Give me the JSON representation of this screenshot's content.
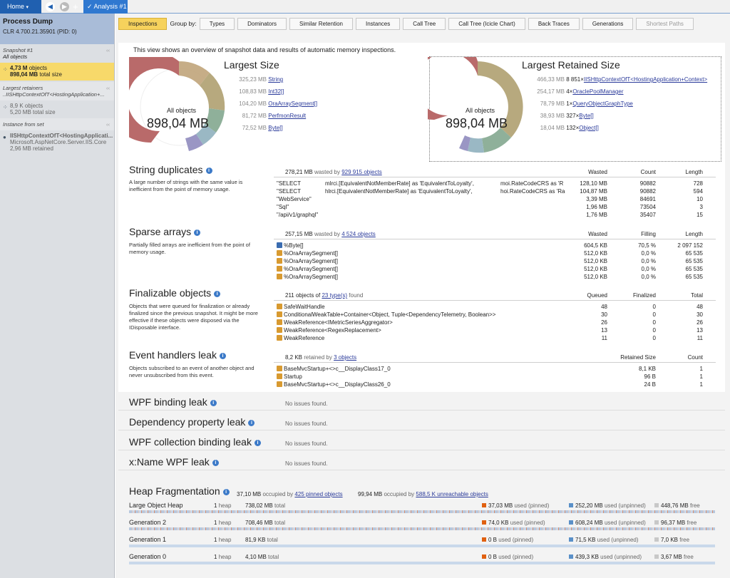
{
  "topbar": {
    "home": "Home",
    "analysis_tab": "Analysis #1",
    "plus": "+"
  },
  "sidebar": {
    "title": "Process Dump",
    "clr": "CLR 4.700.21.35901 (PID: 0)",
    "snapshot_label": "Snapshot #1",
    "snapshot_sub": "All objects",
    "sel_objects": "4,73 M",
    "sel_objects_lbl": "objects",
    "sel_size": "898,04 MB",
    "sel_size_lbl": "total size",
    "retainers_label": "Largest retainers",
    "retainers_sub": "..IISHttpContextOfT<HostingApplication+...",
    "ret_objects": "8,9 K",
    "ret_objects_lbl": "objects",
    "ret_size": "5,20 MB",
    "ret_size_lbl": "total size",
    "instance_label": "Instance from set",
    "inst_name": "IISHttpContextOfT<HostingApplicati...",
    "inst_ns": "Microsoft.AspNetCore.Server.IIS.Core",
    "inst_ret": "2,96 MB retained",
    "collapse": "‹‹"
  },
  "tabs": {
    "inspections": "Inspections",
    "group_by": "Group by:",
    "types": "Types",
    "dominators": "Dominators",
    "similar": "Similar Retention",
    "instances": "Instances",
    "calltree": "Call Tree",
    "icicle": "Call Tree (Icicle Chart)",
    "backtraces": "Back Traces",
    "generations": "Generations",
    "shortest": "Shortest Paths"
  },
  "overview": {
    "text": "This view shows an overview of snapshot data and results of automatic memory inspections.",
    "largest_size": "Largest Size",
    "largest_retained": "Largest Retained Size",
    "all_objects": "All objects",
    "total": "898,04 MB",
    "ls_items": [
      {
        "v": "325,23 MB",
        "n": "String",
        "p": ""
      },
      {
        "v": "108,83 MB",
        "n": "Int32[]",
        "p": ""
      },
      {
        "v": "104,20 MB",
        "n": "OraArraySegment[]",
        "p": ""
      },
      {
        "v": "81,72 MB",
        "n": "PerfmonResult",
        "p": ""
      },
      {
        "v": "72,52 MB",
        "n": "Byte[]",
        "p": ""
      }
    ],
    "lr_items": [
      {
        "v": "466,33 MB",
        "p": "8 851×",
        "n": "IISHttpContextOfT<HostingApplication+Context>"
      },
      {
        "v": "254,17 MB",
        "p": "4×",
        "n": "OraclePoolManager"
      },
      {
        "v": "78,79 MB",
        "p": "1×",
        "n": "QueryObjectGraphType"
      },
      {
        "v": "38,93 MB",
        "p": "327×",
        "n": "Byte[]"
      },
      {
        "v": "18,04 MB",
        "p": "132×",
        "n": "Object[]"
      }
    ]
  },
  "strdup": {
    "title": "String duplicates",
    "sum_pre": "278,21 MB",
    "sum_mid": "wasted by",
    "sum_link": "929 915 objects",
    "desc": "A large number of strings with the same value is inefficient from the point of memory usage.",
    "cols": [
      "Wasted",
      "Count",
      "Length"
    ],
    "rows": [
      {
        "a": "\"SELECT",
        "b": "mlrci.[EquivalentNotMemberRate] as 'EquivalentToLoyalty',",
        "c": "moi.RateCodeCRS as 'R",
        "w": "128,10 MB",
        "n": "90882",
        "l": "728"
      },
      {
        "a": "\"SELECT",
        "b": "hlrci.[EquivalentNotMemberRate] as 'EquivalentToLoyalty',",
        "c": "hoi.RateCodeCRS as 'Ra",
        "w": "104,87 MB",
        "n": "90882",
        "l": "594"
      },
      {
        "a": "\"WebService\"",
        "b": "",
        "c": "",
        "w": "3,39 MB",
        "n": "84691",
        "l": "10"
      },
      {
        "a": "\"Sql\"",
        "b": "",
        "c": "",
        "w": "1,96 MB",
        "n": "73504",
        "l": "3"
      },
      {
        "a": "\"/api/v1/graphql\"",
        "b": "",
        "c": "",
        "w": "1,76 MB",
        "n": "35407",
        "l": "15"
      }
    ]
  },
  "sparse": {
    "title": "Sparse arrays",
    "sum_pre": "257,15 MB",
    "sum_mid": "wasted by",
    "sum_link": "4 524 objects",
    "desc": "Partially filled arrays are inefficient from the point of memory usage.",
    "cols": [
      "Wasted",
      "Filling",
      "Length"
    ],
    "rows": [
      {
        "n": "%Byte[]",
        "w": "604,5 KB",
        "f": "70,5 %",
        "l": "2 097 152"
      },
      {
        "n": "%OraArraySegment[]",
        "w": "512,0 KB",
        "f": "0,0 %",
        "l": "65 535"
      },
      {
        "n": "%OraArraySegment[]",
        "w": "512,0 KB",
        "f": "0,0 %",
        "l": "65 535"
      },
      {
        "n": "%OraArraySegment[]",
        "w": "512,0 KB",
        "f": "0,0 %",
        "l": "65 535"
      },
      {
        "n": "%OraArraySegment[]",
        "w": "512,0 KB",
        "f": "0,0 %",
        "l": "65 535"
      }
    ]
  },
  "final": {
    "title": "Finalizable objects",
    "sum_pre": "211 objects of",
    "sum_link": "23 type(s)",
    "sum_post": "found",
    "desc": "Objects that were queued for finalization or already finalized since the previous snapshot. It might be more effective if these objects were disposed via the IDisposable interface.",
    "cols": [
      "Queued",
      "Finalized",
      "Total"
    ],
    "rows": [
      {
        "n": "SafeWaitHandle",
        "q": "48",
        "f": "0",
        "t": "48"
      },
      {
        "n": "ConditionalWeakTable+Container<Object, Tuple<DependencyTelemetry, Boolean>>",
        "q": "30",
        "f": "0",
        "t": "30"
      },
      {
        "n": "WeakReference<IMetricSeriesAggregator>",
        "q": "26",
        "f": "0",
        "t": "26"
      },
      {
        "n": "WeakReference<RegexReplacement>",
        "q": "13",
        "f": "0",
        "t": "13"
      },
      {
        "n": "WeakReference",
        "q": "11",
        "f": "0",
        "t": "11"
      }
    ]
  },
  "events": {
    "title": "Event handlers leak",
    "sum_pre": "8,2 KB",
    "sum_mid": "retained by",
    "sum_link": "3 objects",
    "desc": "Objects subscribed to an event of another object and never unsubscribed from this event.",
    "cols": [
      "Retained Size",
      "Count"
    ],
    "rows": [
      {
        "n": "BaseMvcStartup+<>c__DisplayClass17_0",
        "s": "8,1 KB",
        "c": "1"
      },
      {
        "n": "Startup",
        "s": "96 B",
        "c": "1"
      },
      {
        "n": "BaseMvcStartup+<>c__DisplayClass26_0",
        "s": "24 B",
        "c": "1"
      }
    ]
  },
  "noissue": {
    "text": "No issues found.",
    "wpf_binding": "WPF binding leak",
    "dep_prop": "Dependency property leak",
    "wpf_coll": "WPF collection binding leak",
    "xname": "x:Name WPF leak"
  },
  "heap": {
    "title": "Heap Fragmentation",
    "s1": "37,10 MB",
    "s1m": "occupied by",
    "s1l": "425 pinned objects",
    "s2": "99,94 MB",
    "s2m": "occupied by",
    "s2l": "588,5 K unreachable objects",
    "rows": [
      {
        "name": "Large Object Heap",
        "n": "1",
        "nl": "heap",
        "size": "738,02 MB",
        "sl": "total",
        "pin": "37,03 MB",
        "pinl": "used (pinned)",
        "unp": "252,20 MB",
        "unpl": "used (unpinned)",
        "free": "448,76 MB",
        "freel": "free"
      },
      {
        "name": "Generation 2",
        "n": "1",
        "nl": "heap",
        "size": "708,46 MB",
        "sl": "total",
        "pin": "74,0 KB",
        "pinl": "used (pinned)",
        "unp": "608,24 MB",
        "unpl": "used (unpinned)",
        "free": "96,37 MB",
        "freel": "free"
      },
      {
        "name": "Generation 1",
        "n": "1",
        "nl": "heap",
        "size": "81,9 KB",
        "sl": "total",
        "pin": "0 B",
        "pinl": "used (pinned)",
        "unp": "71,5 KB",
        "unpl": "used (unpinned)",
        "free": "7,0 KB",
        "freel": "free"
      },
      {
        "name": "Generation 0",
        "n": "1",
        "nl": "heap",
        "size": "4,10 MB",
        "sl": "total",
        "pin": "0 B",
        "pinl": "used (pinned)",
        "unp": "439,3 KB",
        "unpl": "used (unpinned)",
        "free": "3,67 MB",
        "freel": "free"
      }
    ]
  },
  "colors": {
    "accent": "#f6d25c",
    "link": "#2a3a9a",
    "pinned": "#e06010",
    "unpinned": "#5a90c8",
    "free": "#c8c8c8"
  }
}
